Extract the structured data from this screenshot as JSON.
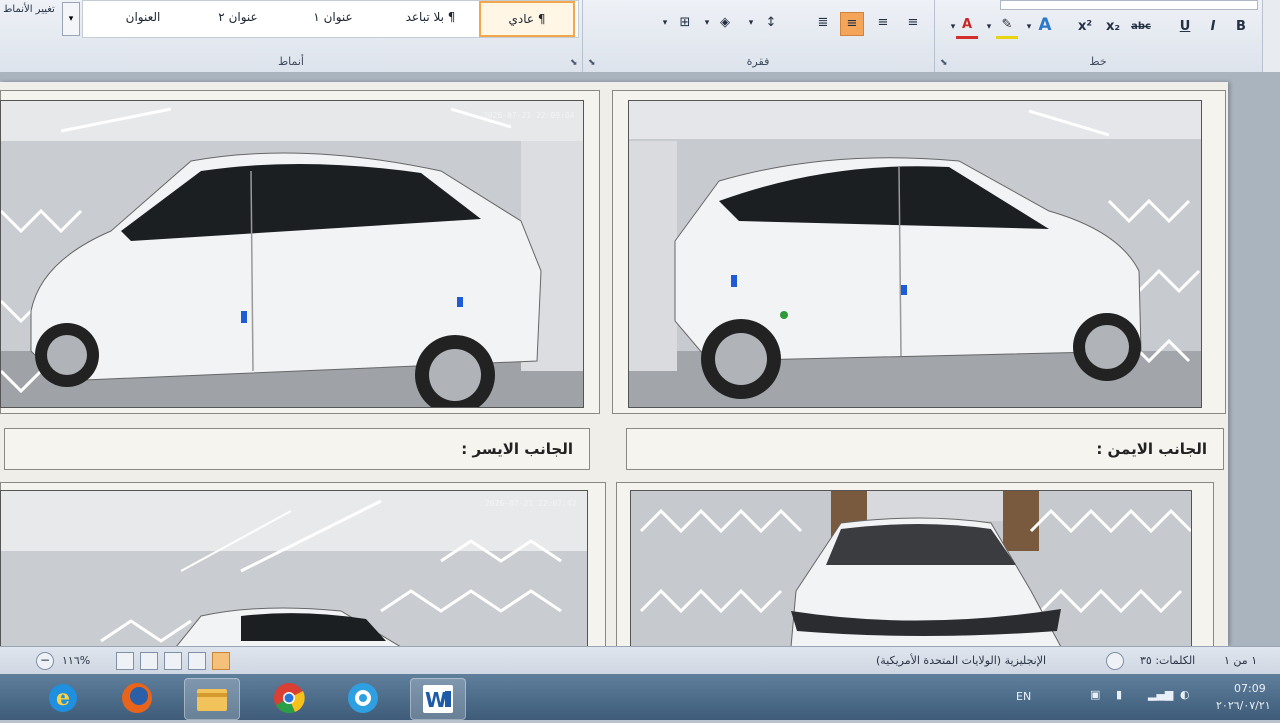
{
  "ribbon": {
    "change_styles_label": "تغيير الأنماط",
    "styles": {
      "group_label": "أنماط",
      "items": [
        "العنوان",
        "عنوان ٢",
        "عنوان ١",
        "¶ بلا تباعد",
        "¶ عادي"
      ]
    },
    "paragraph": {
      "group_label": "فقرة"
    },
    "font": {
      "group_label": "خط"
    },
    "buttons": {
      "bold": "B",
      "italic": "I",
      "underline": "U",
      "strike": "abc",
      "subscript": "x₂",
      "superscript": "x²",
      "font_color": "A",
      "text_effects": "A"
    }
  },
  "document": {
    "captions": {
      "left_side": "الجانب الايسر :",
      "right_side": "الجانب الايمن :"
    },
    "photos": {
      "top_left_timestamp": "2026-07-21 22:09:04",
      "bottom_left_timestamp": "2026-07-21 22:07:42"
    }
  },
  "statusbar": {
    "page": "١ من ١",
    "words": "الكلمات: ٣٥",
    "language": "الإنجليزية (الولايات المتحدة الأمريكية)",
    "zoom": "%١١٦"
  },
  "taskbar": {
    "apps": [
      "internet-explorer",
      "firefox",
      "file-explorer",
      "chrome",
      "media-player",
      "word"
    ],
    "tray": {
      "lang": "EN",
      "time": "07:09",
      "date": "٢٠٢٦/٠٧/٢١"
    }
  },
  "colors": {
    "accent": "#f4a55a",
    "paper": "#efeee8",
    "ribbon": "#dde3ec"
  }
}
